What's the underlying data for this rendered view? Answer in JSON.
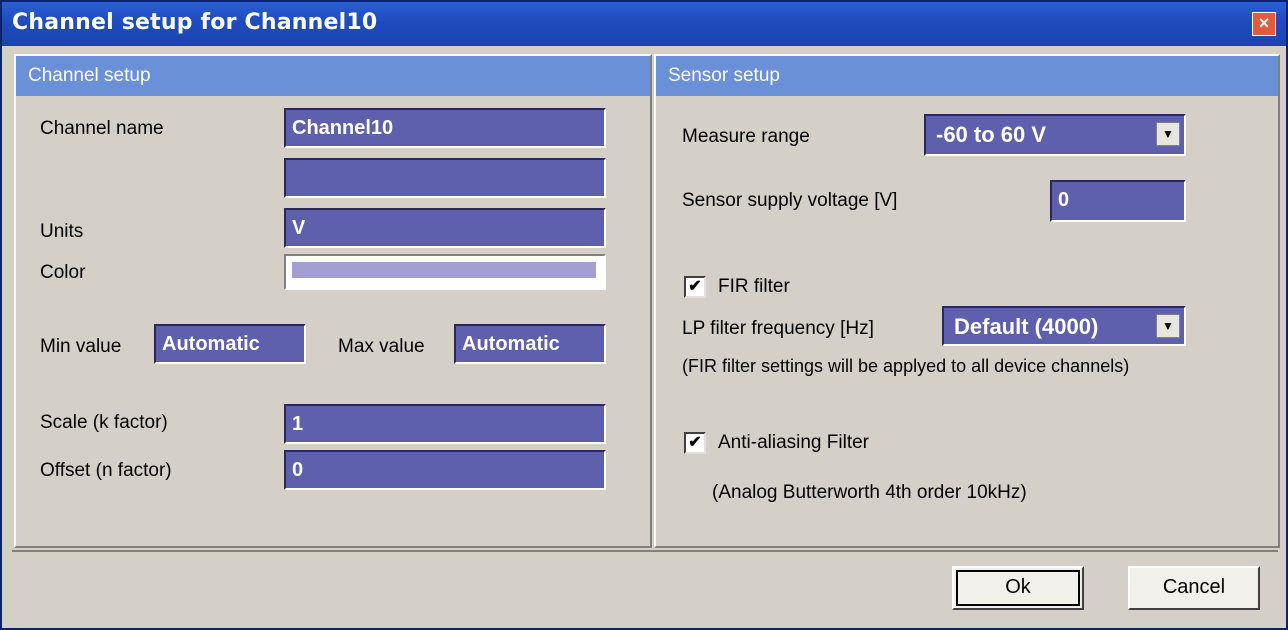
{
  "window": {
    "title": "Channel setup for Channel10",
    "close_label": "×"
  },
  "channel_setup": {
    "header": "Channel setup",
    "channel_name_label": "Channel name",
    "channel_name_value": "Channel10",
    "description_value": "",
    "units_label": "Units",
    "units_value": "V",
    "color_label": "Color",
    "color_value": "#a3a0d0",
    "min_value_label": "Min value",
    "min_value": "Automatic",
    "max_value_label": "Max value",
    "max_value": "Automatic",
    "scale_label": "Scale (k factor)",
    "scale_value": "1",
    "offset_label": "Offset (n factor)",
    "offset_value": "0"
  },
  "sensor_setup": {
    "header": "Sensor setup",
    "measure_range_label": "Measure range",
    "measure_range_value": "-60  to  60 V",
    "supply_voltage_label": "Sensor supply voltage [V]",
    "supply_voltage_value": "0",
    "fir_filter_label": "FIR filter",
    "fir_filter_checked": true,
    "lp_frequency_label": "LP filter frequency [Hz]",
    "lp_frequency_value": "Default (4000)",
    "fir_note": "(FIR filter settings will be applyed to all device channels)",
    "anti_aliasing_label": "Anti-aliasing Filter",
    "anti_aliasing_checked": true,
    "anti_aliasing_note": "(Analog Butterworth 4th order 10kHz)"
  },
  "buttons": {
    "ok": "Ok",
    "cancel": "Cancel"
  },
  "icons": {
    "dropdown": "chevron-down-icon",
    "close": "close-icon",
    "check": "checkmark-icon"
  },
  "colors": {
    "title_bar": "#1f4bbd",
    "panel_header": "#6a90d8",
    "field_bg": "#5e5fad"
  }
}
